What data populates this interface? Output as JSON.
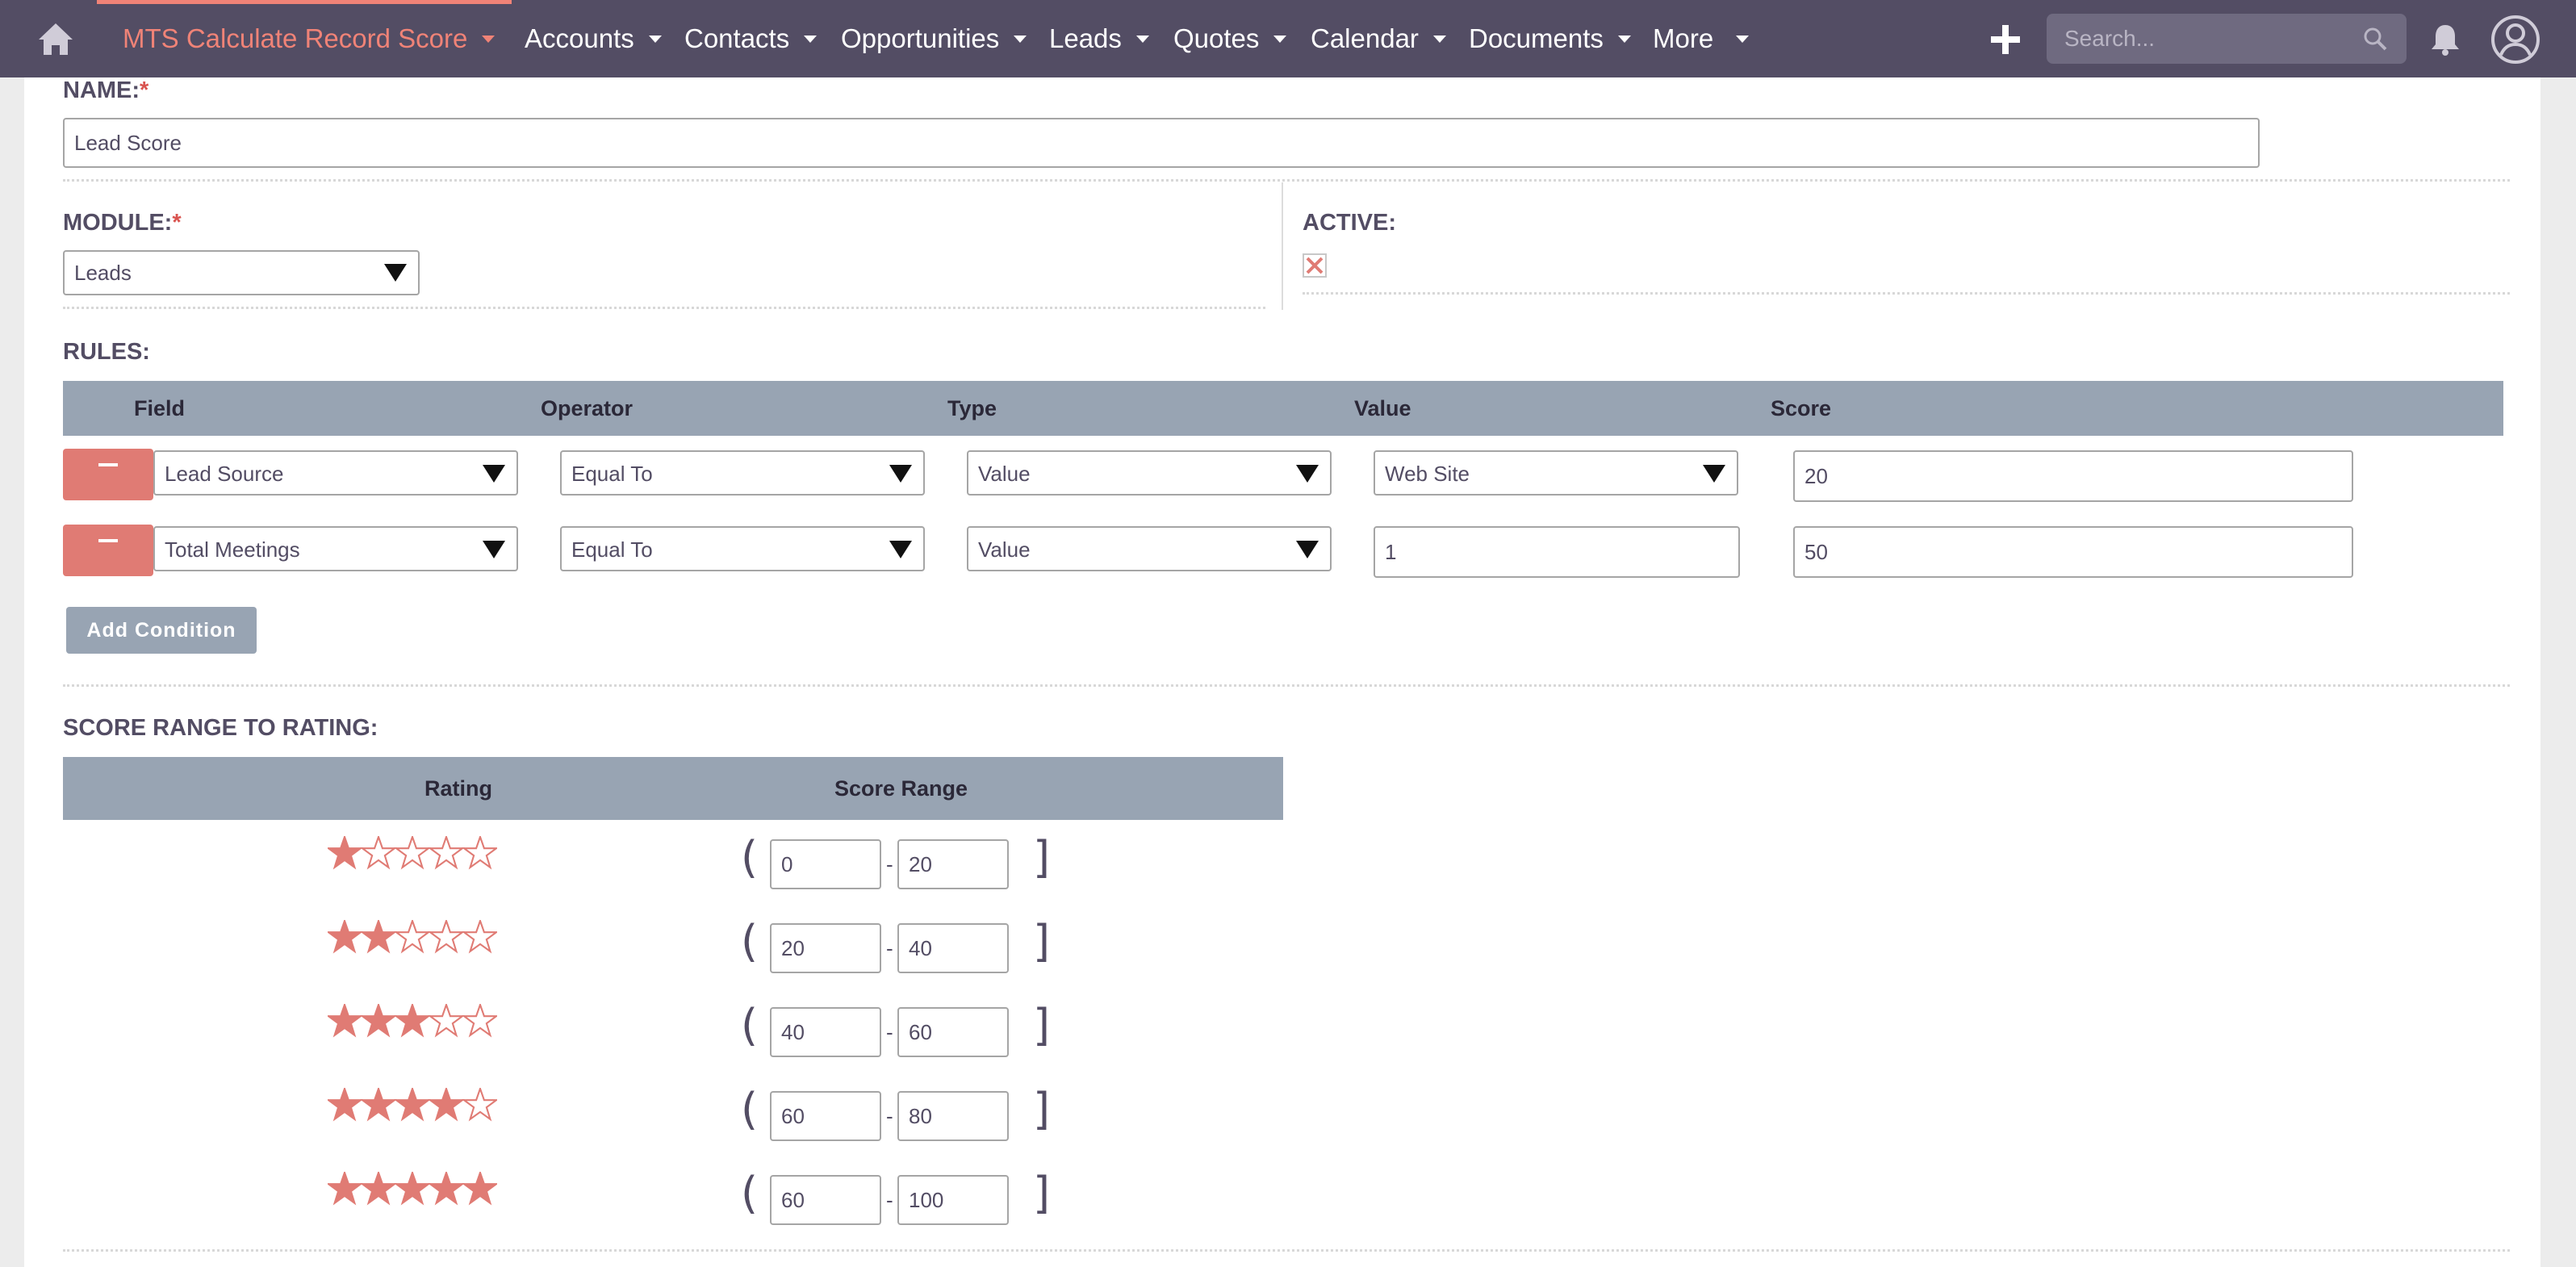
{
  "nav": {
    "active_module": "MTS Calculate Record Score",
    "items": [
      "Accounts",
      "Contacts",
      "Opportunities",
      "Leads",
      "Quotes",
      "Calendar",
      "Documents",
      "More"
    ],
    "search_placeholder": "Search..."
  },
  "colors": {
    "nav_bg": "#534d64",
    "accent": "#f08377",
    "header_bg": "#98a4b3",
    "remove_btn": "#e07b74"
  },
  "form": {
    "name_label": "NAME:",
    "name_value": "Lead Score",
    "module_label": "MODULE:",
    "module_value": "Leads",
    "active_label": "ACTIVE:",
    "active_checked": false,
    "required_marker": "*"
  },
  "rules": {
    "label": "RULES:",
    "headers": [
      "Field",
      "Operator",
      "Type",
      "Value",
      "Score"
    ],
    "rows": [
      {
        "field": "Lead Source",
        "operator": "Equal To",
        "type": "Value",
        "value": "Web Site",
        "value_is_select": true,
        "score": "20"
      },
      {
        "field": "Total Meetings",
        "operator": "Equal To",
        "type": "Value",
        "value": "1",
        "value_is_select": false,
        "score": "50"
      }
    ],
    "add_button": "Add Condition"
  },
  "ranges": {
    "label": "SCORE RANGE TO RATING:",
    "headers": [
      "Rating",
      "Score Range"
    ],
    "rows": [
      {
        "stars": 1,
        "min": "0",
        "max": "20"
      },
      {
        "stars": 2,
        "min": "20",
        "max": "40"
      },
      {
        "stars": 3,
        "min": "40",
        "max": "60"
      },
      {
        "stars": 4,
        "min": "60",
        "max": "80"
      },
      {
        "stars": 5,
        "min": "60",
        "max": "100"
      }
    ],
    "open_bracket": "(",
    "close_bracket": "]",
    "separator": "-"
  }
}
